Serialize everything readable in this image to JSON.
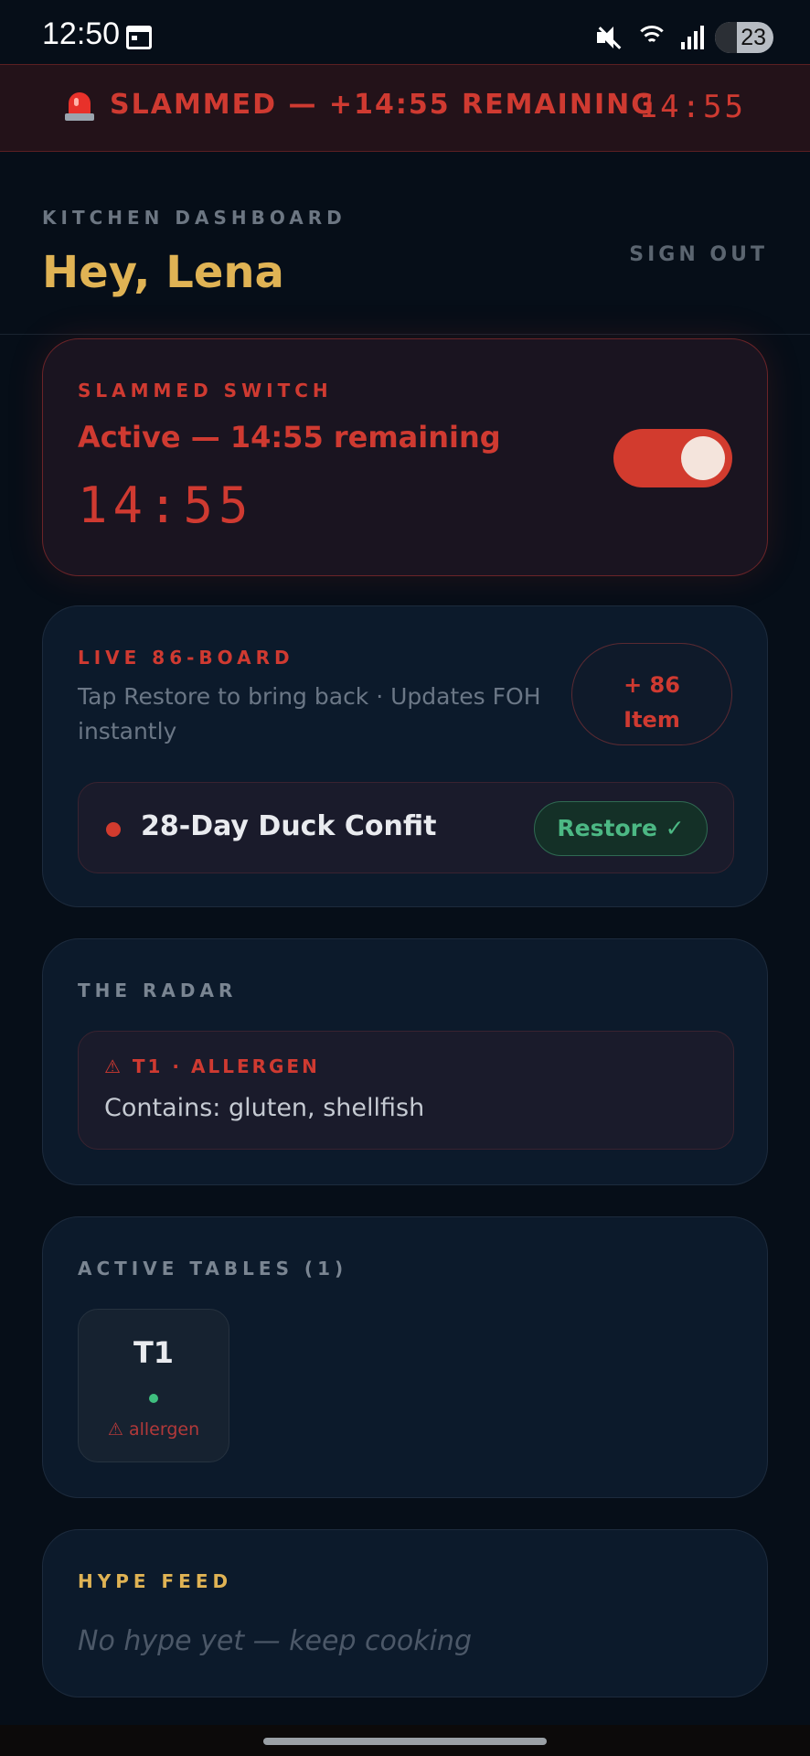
{
  "status_bar": {
    "time": "12:50",
    "battery": "23",
    "icons": [
      "calendar-icon",
      "mute-icon",
      "wifi-icon",
      "signal-icon",
      "battery-icon"
    ]
  },
  "banner": {
    "icon": "siren-icon",
    "text": "SLAMMED — +14:55 REMAINING",
    "timer": "14:55"
  },
  "header": {
    "kicker": "KITCHEN DASHBOARD",
    "greeting": "Hey, Lena",
    "sign_out": "SIGN OUT"
  },
  "slammed_switch": {
    "label": "SLAMMED SWITCH",
    "status": "Active — 14:55 remaining",
    "timer": "14:55",
    "on": true
  },
  "board": {
    "label": "LIVE 86-BOARD",
    "subtitle": "Tap Restore to bring back · Updates FOH instantly",
    "add_line1": "+ 86",
    "add_line2": "Item",
    "items": [
      {
        "name": "28-Day Duck Confit",
        "action": "Restore ✓"
      }
    ]
  },
  "radar": {
    "label": "THE RADAR",
    "alerts": [
      {
        "title": "⚠ T1 · ALLERGEN",
        "text": "Contains: gluten, shellfish"
      }
    ]
  },
  "tables": {
    "label": "ACTIVE TABLES (1)",
    "items": [
      {
        "name": "T1",
        "flag": "⚠ allergen"
      }
    ]
  },
  "hype": {
    "label": "HYPE FEED",
    "empty": "No hype yet — keep cooking"
  },
  "colors": {
    "background": "#060e18",
    "alert_red": "#cf3a31",
    "gold": "#e0b354",
    "restore_green": "#4cb884"
  }
}
